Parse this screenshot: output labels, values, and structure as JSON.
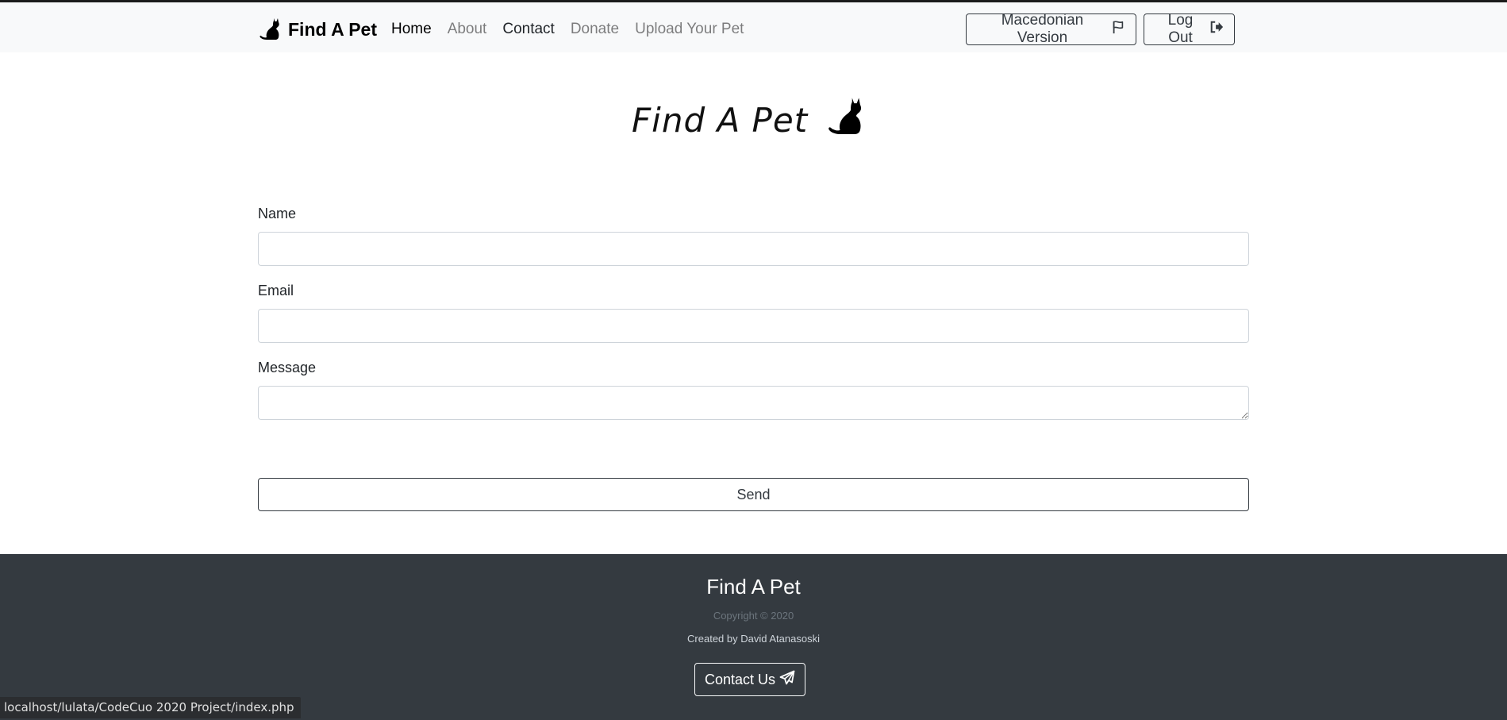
{
  "navbar": {
    "brand": "Find A Pet",
    "links": [
      {
        "label": "Home"
      },
      {
        "label": "About"
      },
      {
        "label": "Contact"
      },
      {
        "label": "Donate"
      },
      {
        "label": "Upload Your Pet"
      }
    ],
    "macedonian_btn": "Macedonian Version",
    "logout_btn": "Log Out"
  },
  "hero": {
    "title": "Find A Pet"
  },
  "form": {
    "name_label": "Name",
    "name_value": "",
    "email_label": "Email",
    "email_value": "",
    "message_label": "Message",
    "message_value": "",
    "send_label": "Send"
  },
  "footer": {
    "title": "Find A Pet",
    "copyright": "Copyright © 2020",
    "created_by": "Created by David Atanasoski",
    "contact_btn": "Contact Us"
  },
  "status_bar": {
    "url": "localhost/lulata/CodeCuo 2020 Project/index.php"
  },
  "icons": {
    "brand": "cat-icon",
    "macedonian": "flag-icon",
    "logout": "sign-out-icon",
    "contact": "paper-plane-icon"
  },
  "colors": {
    "navbar_bg": "#f8f9fa",
    "footer_bg": "#343a40",
    "border_dark": "#343a40"
  }
}
